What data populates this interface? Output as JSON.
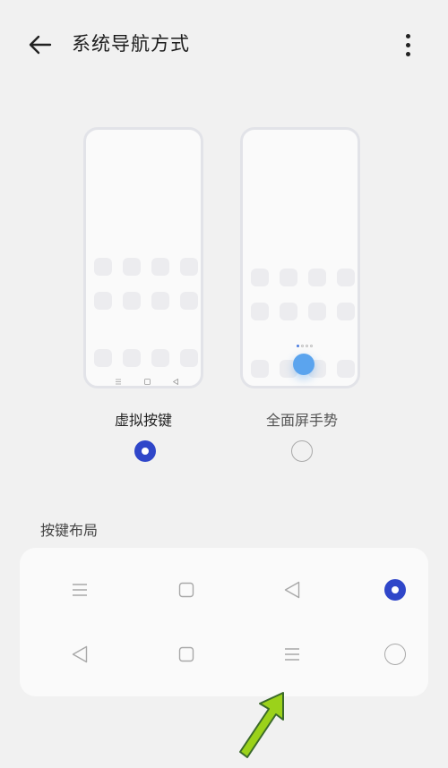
{
  "header": {
    "title": "系统导航方式",
    "back_icon": "arrow-left-icon",
    "more_icon": "more-vertical-icon"
  },
  "nav_options": [
    {
      "label": "虚拟按键",
      "selected": true
    },
    {
      "label": "全面屏手势",
      "selected": false
    }
  ],
  "key_layout": {
    "section_label": "按键布局",
    "rows": [
      {
        "keys": [
          "menu-icon",
          "square-icon",
          "triangle-back-icon"
        ],
        "selected": true
      },
      {
        "keys": [
          "triangle-back-icon",
          "square-icon",
          "menu-icon"
        ],
        "selected": false
      }
    ]
  },
  "colors": {
    "accent": "#2f46c9",
    "background": "#f1f1f1",
    "card": "#fafafa",
    "gesture": "#5ba4ee",
    "annotation_arrow": "#9bd21a"
  }
}
